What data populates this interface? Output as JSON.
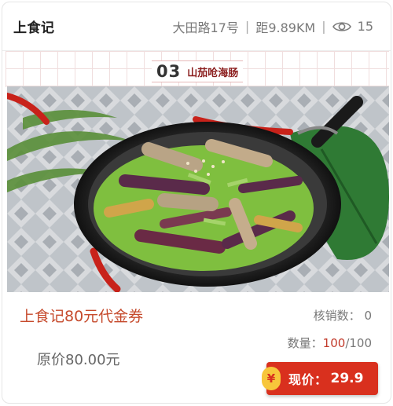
{
  "header": {
    "shop_name": "上食记",
    "address": "大田路17号",
    "distance": "距9.89KM",
    "views": "15",
    "views_icon": "eye-icon"
  },
  "caption": {
    "number": "03",
    "dish": "山茄呛海肠"
  },
  "photo": {
    "subject": "dish-photo"
  },
  "coupon": {
    "title": "上食记80元代金券",
    "verified_label": "核销数：",
    "verified_count": "0",
    "stock_label": "数量：",
    "stock_remaining": "100",
    "stock_total": "/100",
    "original_price": "原价80.00元",
    "price_icon": "yuan-icon",
    "price_icon_glyph": "¥",
    "current_price_label": "现价：",
    "current_price_value": "29.9"
  },
  "colors": {
    "accent_red": "#d9301e",
    "title_orange": "#c64a2c",
    "badge_yellow": "#f7c63b"
  }
}
